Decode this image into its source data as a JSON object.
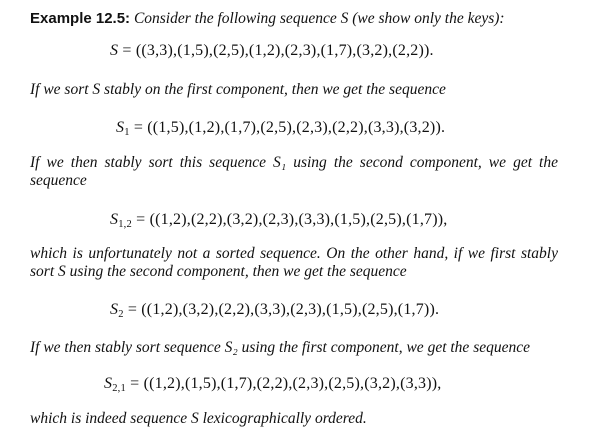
{
  "example": {
    "label": "Example 12.5:",
    "intro": "Consider the following sequence S (we show only the keys):"
  },
  "eq_S": {
    "lhs": "S",
    "rhs": "= ((3,3),(1,5),(2,5),(1,2),(2,3),(1,7),(3,2),(2,2))."
  },
  "text1": "If we sort S stably on the first component, then we get the sequence",
  "eq_S1": {
    "lhs": "S",
    "sub": "1",
    "rhs": "= ((1,5),(1,2),(1,7),(2,5),(2,3),(2,2),(3,3),(3,2))."
  },
  "text2": {
    "line1": "If we then stably sort this sequence S₁ using the second component, we get the",
    "line2": "sequence"
  },
  "eq_S12": {
    "lhs": "S",
    "sub": "1,2",
    "rhs": "= ((1,2),(2,2),(3,2),(2,3),(3,3),(1,5),(2,5),(1,7)),"
  },
  "text3": {
    "line1": "which is unfortunately not a sorted sequence. On the other hand, if we first stably",
    "line2": "sort S using the second component, then we get the sequence"
  },
  "eq_S2": {
    "lhs": "S",
    "sub": "2",
    "rhs": "= ((1,2),(3,2),(2,2),(3,3),(2,3),(1,5),(2,5),(1,7))."
  },
  "text4": "If we then stably sort sequence S₂ using the first component, we get the sequence",
  "eq_S21": {
    "lhs": "S",
    "sub": "2,1",
    "rhs": "= ((1,2),(1,5),(1,7),(2,2),(2,3),(2,5),(3,2),(3,3)),"
  },
  "text5": "which is indeed sequence S lexicographically ordered."
}
